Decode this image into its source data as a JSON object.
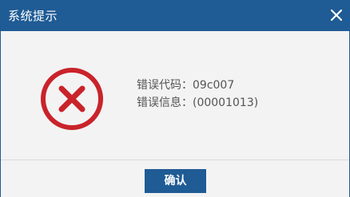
{
  "dialog": {
    "title": "系统提示",
    "close_icon": "close-icon",
    "error_icon": "error-x-icon",
    "error_code_label": "错误代码：",
    "error_code_value": "09c007",
    "error_info_label": "错误信息：",
    "error_info_value": "(00001013)",
    "confirm_label": "确认"
  },
  "colors": {
    "titlebar": "#1f5b95",
    "button": "#1f5b95",
    "error_red": "#c9232b",
    "body_bg": "#f3f3f3",
    "text": "#555555"
  }
}
